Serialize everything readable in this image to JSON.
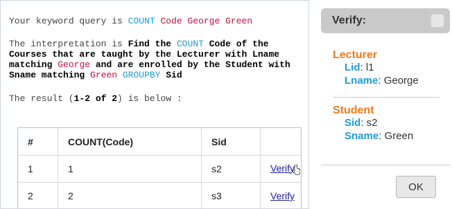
{
  "query": {
    "prefix": "Your keyword query is",
    "kw1": "COUNT",
    "kw2": "Code George Green"
  },
  "interpretation": {
    "prefix": "The interpretation is",
    "t1": "Find the",
    "count": "COUNT",
    "t2": "Code of the Courses that are taught by the Lecturer with Lname matching",
    "george": "George",
    "t3": "and are enrolled by the Student with Sname matching",
    "green": "Green",
    "groupby": "GROUPBY",
    "sid": "Sid"
  },
  "result": {
    "prefix": "The result (",
    "range": "1-2 of 2",
    "suffix": ") is below :"
  },
  "table": {
    "headers": [
      "#",
      "COUNT(Code)",
      "Sid",
      ""
    ],
    "rows": [
      {
        "num": "1",
        "count": "1",
        "sid": "s2",
        "action": "Verify"
      },
      {
        "num": "2",
        "count": "2",
        "sid": "s3",
        "action": "Verify"
      }
    ]
  },
  "verify_panel": {
    "title": "Verify:",
    "lecturer": {
      "label": "Lecturer",
      "lid_key": "Lid",
      "lid_val": ": l1",
      "lname_key": "Lname",
      "lname_val": ": George"
    },
    "student": {
      "label": "Student",
      "sid_key": "Sid",
      "sid_val": ": s2",
      "sname_key": "Sname",
      "sname_val": ": Green"
    },
    "ok_label": "OK"
  },
  "colors": {
    "keyword_blue": "#1f9bd6",
    "keyword_red": "#c0143c",
    "entity_orange": "#f07a1a",
    "link": "#1a1aa6"
  }
}
